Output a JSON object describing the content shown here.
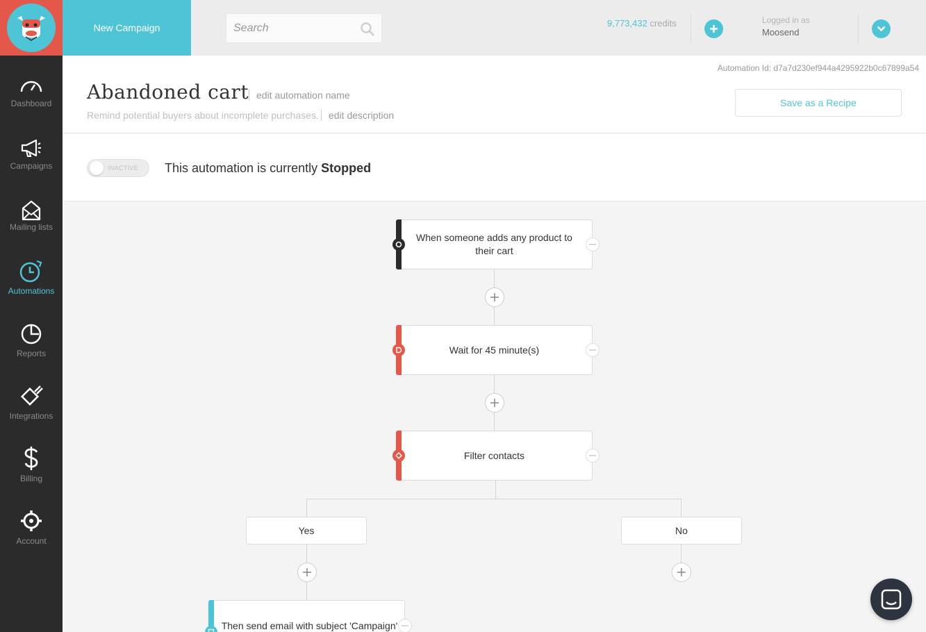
{
  "app": {
    "logo_icon": "moose-logo-icon",
    "new_campaign_label": "New Campaign"
  },
  "search": {
    "placeholder": "Search",
    "value": ""
  },
  "credits": {
    "amount": "9,773,432",
    "label": "credits"
  },
  "user": {
    "logged_in_label": "Logged in as",
    "name": "Moosend"
  },
  "sidebar": {
    "items": [
      {
        "label": "Dashboard",
        "icon": "dashboard-icon",
        "active": false
      },
      {
        "label": "Campaigns",
        "icon": "megaphone-icon",
        "active": false
      },
      {
        "label": "Mailing lists",
        "icon": "envelope-icon",
        "active": false
      },
      {
        "label": "Automations",
        "icon": "clock-icon",
        "active": true
      },
      {
        "label": "Reports",
        "icon": "pie-chart-icon",
        "active": false
      },
      {
        "label": "Integrations",
        "icon": "plug-icon",
        "active": false
      },
      {
        "label": "Billing",
        "icon": "dollar-icon",
        "active": false
      },
      {
        "label": "Account",
        "icon": "gear-icon",
        "active": false
      }
    ]
  },
  "automation": {
    "id_text": "Automation Id: d7a7d230ef944a4295922b0c67899a54",
    "title": "Abandoned cart",
    "edit_name_label": "edit automation name",
    "description": "Remind potential buyers about incomplete purchases.",
    "edit_description_label": "edit description",
    "save_recipe_label": "Save as a Recipe",
    "toggle_label": "INACTIVE",
    "status_prefix": "This automation is currently",
    "status_value": "Stopped"
  },
  "flow": {
    "trigger": "When someone adds any product to their cart",
    "wait": "Wait for 45 minute(s)",
    "filter": "Filter contacts",
    "branch_yes": "Yes",
    "branch_no": "No",
    "action": "Then send email with subject 'Campaign'"
  },
  "colors": {
    "accent": "#4ec5d6",
    "brand_red": "#e4584b",
    "sidebar_bg": "#2b2b2b",
    "trigger_bar": "#2b2b2b",
    "delay_bar": "#e4584b",
    "action_bar": "#4ec5d6"
  }
}
